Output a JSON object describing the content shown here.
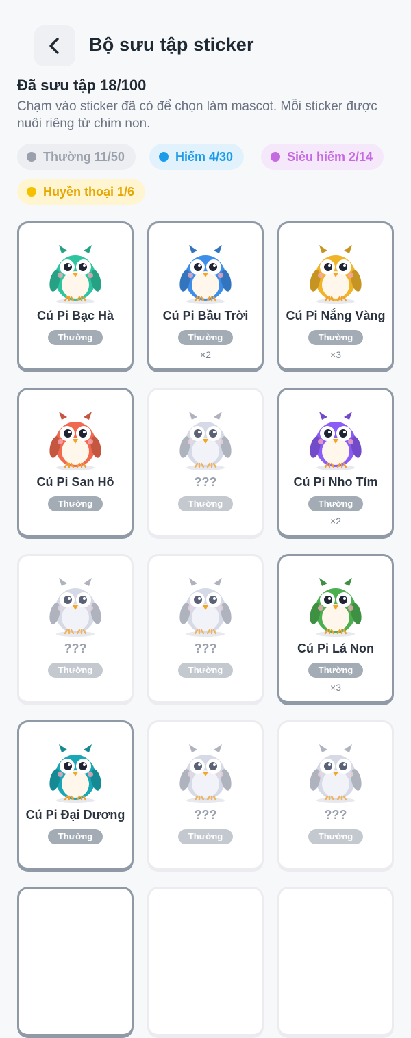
{
  "header": {
    "title": "Bộ sưu tập sticker",
    "collected": "Đã sưu tập 18/100",
    "subtitle": "Chạm vào sticker đã có để chọn làm mascot. Mỗi sticker được nuôi riêng từ chim non."
  },
  "filters": [
    {
      "label": "Thường 11/50",
      "color": "#9aa1ac"
    },
    {
      "label": "Hiếm 4/30",
      "color": "#1e9be8"
    },
    {
      "label": "Siêu hiếm 2/14",
      "color": "#c56ae0"
    },
    {
      "label": "Huyền thoại 1/6",
      "color": "#f5c000"
    }
  ],
  "stickers": [
    {
      "name": "Cú Pi Bạc Hà",
      "rarity": "Thường",
      "count": "",
      "color": "#2ec4a0",
      "locked": false
    },
    {
      "name": "Cú Pi Bầu Trời",
      "rarity": "Thường",
      "count": "×2",
      "color": "#3d8ee8",
      "locked": false
    },
    {
      "name": "Cú Pi Nắng Vàng",
      "rarity": "Thường",
      "count": "×3",
      "color": "#f0b429",
      "locked": false
    },
    {
      "name": "Cú Pi San Hô",
      "rarity": "Thường",
      "count": "",
      "color": "#f06a4f",
      "locked": false
    },
    {
      "name": "???",
      "rarity": "Thường",
      "count": "",
      "color": "#d6dae6",
      "locked": true
    },
    {
      "name": "Cú Pi Nho Tím",
      "rarity": "Thường",
      "count": "×2",
      "color": "#8b5cf6",
      "locked": false
    },
    {
      "name": "???",
      "rarity": "Thường",
      "count": "",
      "color": "#d6dae6",
      "locked": true
    },
    {
      "name": "???",
      "rarity": "Thường",
      "count": "",
      "color": "#d6dae6",
      "locked": true
    },
    {
      "name": "Cú Pi Lá Non",
      "rarity": "Thường",
      "count": "×3",
      "color": "#4caf50",
      "locked": false
    },
    {
      "name": "Cú Pi Đại Dương",
      "rarity": "Thường",
      "count": "",
      "color": "#1aa7b5",
      "locked": false
    },
    {
      "name": "???",
      "rarity": "Thường",
      "count": "",
      "color": "#d6dae6",
      "locked": true
    },
    {
      "name": "???",
      "rarity": "Thường",
      "count": "",
      "color": "#d6dae6",
      "locked": true
    }
  ],
  "icons": {
    "back": "chevron-left-icon",
    "sticker": "owl-icon"
  }
}
